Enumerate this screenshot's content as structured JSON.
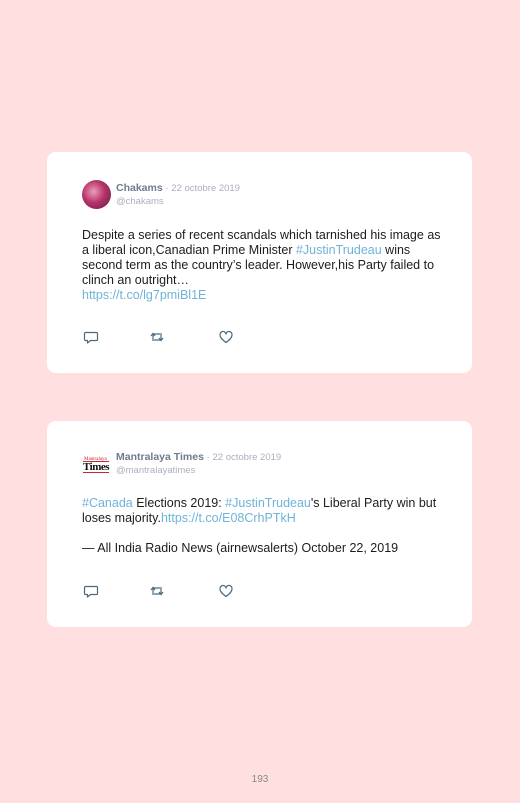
{
  "tweets": [
    {
      "name": "Chakams",
      "date": "· 22 octobre 2019",
      "handle": "@chakams",
      "body": {
        "p1": "Despite a series of recent scandals which tarnished his image as a liberal icon,Canadian Prime Minister ",
        "tag1": "#JustinTrudeau",
        "p2": " wins second term as the country’s leader. However,his Party failed to clinch an outright…",
        "link": "https://t.co/lg7pmiBl1E"
      }
    },
    {
      "name": "Mantralaya Times",
      "date": "· 22 octobre 2019",
      "handle": "@mantralayatimes",
      "logo": {
        "top": "Mantralaya",
        "main": "Times"
      },
      "body": {
        "tag1": "#Canada",
        "p1": " Elections 2019: ",
        "tag2": "#JustinTrudeau",
        "p2": "'s Liberal Party win but loses majority.",
        "link": "https://t.co/E08CrhPTkH",
        "credit": "— All India Radio News (airnewsalerts) October 22, 2019"
      }
    }
  ],
  "icons": [
    "reply-icon",
    "retweet-icon",
    "like-icon"
  ],
  "colors": {
    "background": "#ffdfdf",
    "card": "#ffffff",
    "link": "#6fb3d8",
    "name": "#6f7b8f",
    "meta": "#a9b0bd"
  },
  "page_number": "193"
}
